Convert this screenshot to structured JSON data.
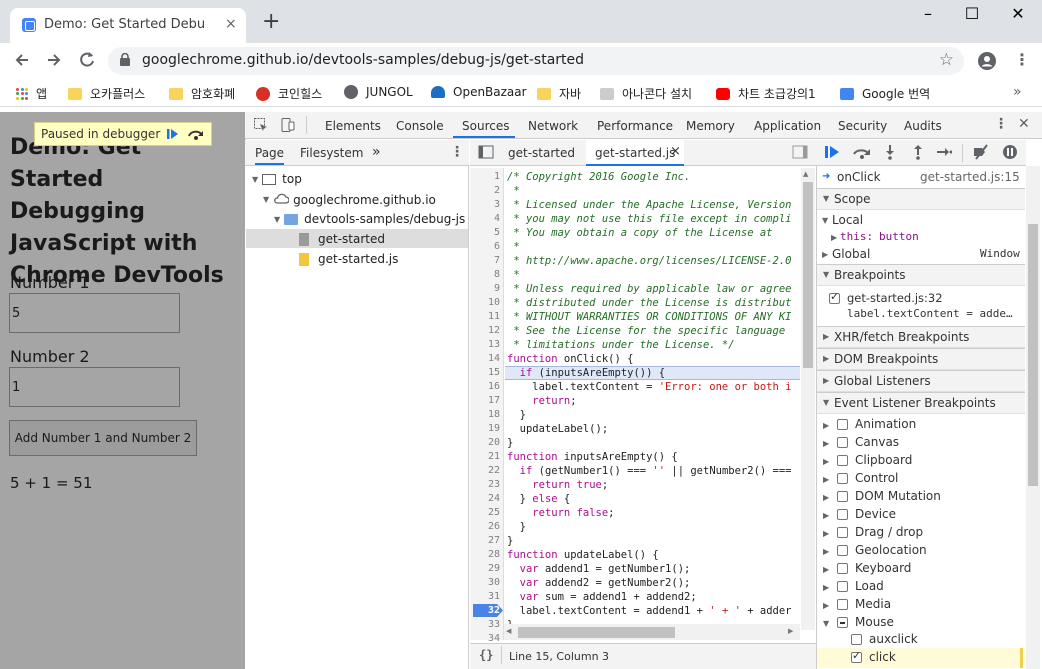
{
  "browser": {
    "tab_title": "Demo: Get Started Debugging JavaScript",
    "tab_close": "×",
    "new_tab": "+",
    "url": "googlechrome.github.io/devtools-samples/debug-js/get-started",
    "window_controls": [
      "–",
      "☐",
      "✕"
    ],
    "bookmarks": [
      {
        "label": "앱",
        "icon": "apps-icon",
        "color": "#4285f4"
      },
      {
        "label": "오카플러스",
        "icon": "folder-icon",
        "color": "#f9d35b"
      },
      {
        "label": "암호화폐",
        "icon": "folder-icon",
        "color": "#f9d35b"
      },
      {
        "label": "코인힐스",
        "icon": "coinhills-icon",
        "color": "#d93025"
      },
      {
        "label": "JUNGOL",
        "icon": "globe-icon",
        "color": "#5f6368"
      },
      {
        "label": "OpenBazaar",
        "icon": "openbazaar-icon",
        "color": "#1b6ec2"
      },
      {
        "label": "자바",
        "icon": "folder-icon",
        "color": "#f9d35b"
      },
      {
        "label": "아나콘다 설치",
        "icon": "wiki-icon",
        "color": "#999999"
      },
      {
        "label": "차트 초급강의1",
        "icon": "youtube-icon",
        "color": "#ff0000"
      },
      {
        "label": "Google 번역",
        "icon": "translate-icon",
        "color": "#4285f4"
      }
    ],
    "more_bookmarks": "»"
  },
  "page": {
    "heading": "Demo: Get Started Debugging JavaScript with Chrome DevTools",
    "number1_label": "Number 1",
    "number1_value": "5",
    "number2_label": "Number 2",
    "number2_value": "1",
    "button_label": "Add Number 1 and Number 2",
    "result": "5 + 1 = 51",
    "paused_text": "Paused in debugger"
  },
  "devtools": {
    "tabs": [
      "Elements",
      "Console",
      "Sources",
      "Network",
      "Performance",
      "Memory",
      "Application",
      "Security",
      "Audits"
    ],
    "active_tab": "Sources",
    "navigator": {
      "tabs": [
        "Page",
        "Filesystem"
      ],
      "more": "»",
      "tree": [
        "top",
        "googlechrome.github.io",
        "devtools-samples/debug-js",
        "get-started",
        "get-started.js"
      ]
    },
    "editor": {
      "tabs": [
        "get-started",
        "get-started.js"
      ],
      "close": "×",
      "status": "Line 15, Column 3",
      "braces": "{}",
      "lines": [
        {
          "n": "1",
          "t": "/* Copyright 2016 Google Inc."
        },
        {
          "n": "2",
          "t": " *"
        },
        {
          "n": "3",
          "t": " * Licensed under the Apache License, Version"
        },
        {
          "n": "4",
          "t": " * you may not use this file except in compli"
        },
        {
          "n": "5",
          "t": " * You may obtain a copy of the License at"
        },
        {
          "n": "6",
          "t": " *"
        },
        {
          "n": "7",
          "t": " * http://www.apache.org/licenses/LICENSE-2.0"
        },
        {
          "n": "8",
          "t": " *"
        },
        {
          "n": "9",
          "t": " * Unless required by applicable law or agree"
        },
        {
          "n": "10",
          "t": " * distributed under the License is distribut"
        },
        {
          "n": "11",
          "t": " * WITHOUT WARRANTIES OR CONDITIONS OF ANY KI"
        },
        {
          "n": "12",
          "t": " * See the License for the specific language"
        },
        {
          "n": "13",
          "t": " * limitations under the License. */"
        },
        {
          "n": "14",
          "t": "function onClick() {"
        },
        {
          "n": "15",
          "t": "  if (inputsAreEmpty()) {"
        },
        {
          "n": "16",
          "t": "    label.textContent = 'Error: one or both i"
        },
        {
          "n": "17",
          "t": "    return;"
        },
        {
          "n": "18",
          "t": "  }"
        },
        {
          "n": "19",
          "t": "  updateLabel();"
        },
        {
          "n": "20",
          "t": "}"
        },
        {
          "n": "21",
          "t": "function inputsAreEmpty() {"
        },
        {
          "n": "22",
          "t": "  if (getNumber1() === '' || getNumber2() ==="
        },
        {
          "n": "23",
          "t": "    return true;"
        },
        {
          "n": "24",
          "t": "  } else {"
        },
        {
          "n": "25",
          "t": "    return false;"
        },
        {
          "n": "26",
          "t": "  }"
        },
        {
          "n": "27",
          "t": "}"
        },
        {
          "n": "28",
          "t": "function updateLabel() {"
        },
        {
          "n": "29",
          "t": "  var addend1 = getNumber1();"
        },
        {
          "n": "30",
          "t": "  var addend2 = getNumber2();"
        },
        {
          "n": "31",
          "t": "  var sum = addend1 + addend2;"
        },
        {
          "n": "32",
          "t": "  label.textContent = addend1 + ' + ' + adder"
        },
        {
          "n": "33",
          "t": "}"
        },
        {
          "n": "34",
          "t": ""
        }
      ]
    },
    "debugger": {
      "call_frame": "onClick",
      "call_location": "get-started.js:15",
      "scope_title": "Scope",
      "local_title": "Local",
      "this_key": "this:",
      "this_value": "button",
      "global_title": "Global",
      "global_value": "Window",
      "breakpoints_title": "Breakpoints",
      "breakpoint_file": "get-started.js:32",
      "breakpoint_code": "label.textContent = adde…",
      "xhr_title": "XHR/fetch Breakpoints",
      "dom_title": "DOM Breakpoints",
      "global_listeners_title": "Global Listeners",
      "event_title": "Event Listener Breakpoints",
      "event_categories": [
        "Animation",
        "Canvas",
        "Clipboard",
        "Control",
        "DOM Mutation",
        "Device",
        "Drag / drop",
        "Geolocation",
        "Keyboard",
        "Load",
        "Media",
        "Mouse"
      ],
      "mouse_children": [
        "auxclick",
        "click"
      ]
    }
  },
  "colors": {
    "accent": "#1a73e8",
    "paused_bg": "#ffffc2",
    "page_overlay": "#a5a5a5",
    "breakpoint": "#4a83e6"
  }
}
